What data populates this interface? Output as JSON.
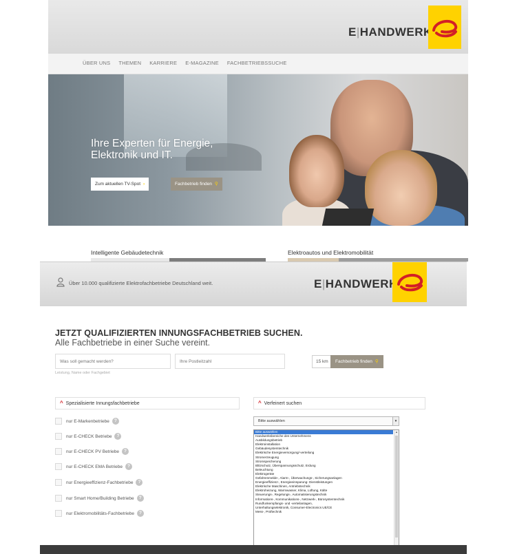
{
  "shot1": {
    "logo_text_left": "E",
    "logo_pipe": "|",
    "logo_text_right": "HANDWERK",
    "nav": [
      "ÜBER UNS",
      "THEMEN",
      "KARRIERE",
      "E-MAGAZINE",
      "FACHBETRIEBSSUCHE"
    ],
    "hero": {
      "title_line1": "Ihre Experten für Energie,",
      "title_line2": "Elektronik und IT.",
      "btn_tv": "Zum aktuellen TV-Spot",
      "btn_tv_arrow": "›",
      "btn_find": "Fachbetrieb finden",
      "magnifier": "⚲"
    },
    "teasers": [
      "Intelligente Gebäudetechnik",
      "Elektroautos und Elektromobilität"
    ]
  },
  "shot2": {
    "header_text": "Über 10.000 qualifizierte Elektrofachbetriebe Deutschland weit.",
    "logo_text_left": "E",
    "logo_pipe": "|",
    "logo_text_right": "HANDWERK",
    "heading": "JETZT QUALIFIZIERTEN INNUNGSFACHBETRIEB SUCHEN.",
    "subheading": "Alle Fachbetriebe in einer Suche vereint.",
    "input_what_placeholder": "Was soll gemacht werden?",
    "input_zip_placeholder": "Ihre Postleitzahl",
    "input_hint": "Leistung, Name oder Fachgebiet",
    "radius_value": "15 km",
    "dropdown_glyph": "▼",
    "btn_find": "Fachbetrieb finden",
    "magnifier": "⚲",
    "panel_spec_title": "Spezialisierte Innungsfachbetriebe",
    "panel_fine_title": "Verfeinert suchen",
    "caret": "^",
    "info_glyph": "?",
    "checkboxes": [
      "nur E-Markenbetriebe",
      "nur E-CHECK Betriebe",
      "nur E-CHECK PV Betriebe",
      "nur E-CHECK EMA Betriebe",
      "nur Energieeffizienz-Fachbetriebe",
      "nur Smart Home/Building Betriebe",
      "nur Elektromobilitäts-Fachbetriebe"
    ],
    "select_value": "Bitte auswählen",
    "list_items": [
      "Bitte auswählen",
      "Handwerksbereiche des Unternehmens",
      "Ausbildungsbetrieb",
      "Elektroinstallation",
      "Gebäudesystemtechnik",
      "Elektrische Energieversorgung/-verteilung",
      "Stromerzeugung",
      "Stromspeicherung",
      "Blitzschutz, Überspannungsschutz, Erdung",
      "Beleuchtung",
      "Elektrogeräte",
      "Gefahrenmelde-, Alarm-, Überwachungs-, Sicherungsanlagen",
      "Energieeffizienz-, Energieeinsparung- Dienstleistungen",
      "Elektrische Maschinen, Antriebstechnik",
      "Elektroheizung, Warmwasser, Klima, Lüftung, Kälte",
      "Steuerungs-, Regelungs-, Automatisierungstechnik",
      "Informations-, Kommunikations-, Netzwerk-, Bürosystemtechnik",
      "Rundfunkempfangs- und -verteilanlagen,",
      "Unterhaltungselektronik, Consumer-Electronics UE/CE",
      "Mess-, Prüftechnik"
    ],
    "scroll_up": "▲",
    "scroll_down": "▼"
  },
  "colors": {
    "brand_yellow": "#ffd200",
    "brand_red": "#d31f26",
    "button_gray": "#9a9385",
    "selection_blue": "#3a7bd5"
  },
  "icons": [
    "user-icon",
    "e-handwerk-logo",
    "magnifier-icon",
    "info-icon",
    "chevron-up-icon",
    "dropdown-arrow-icon"
  ]
}
